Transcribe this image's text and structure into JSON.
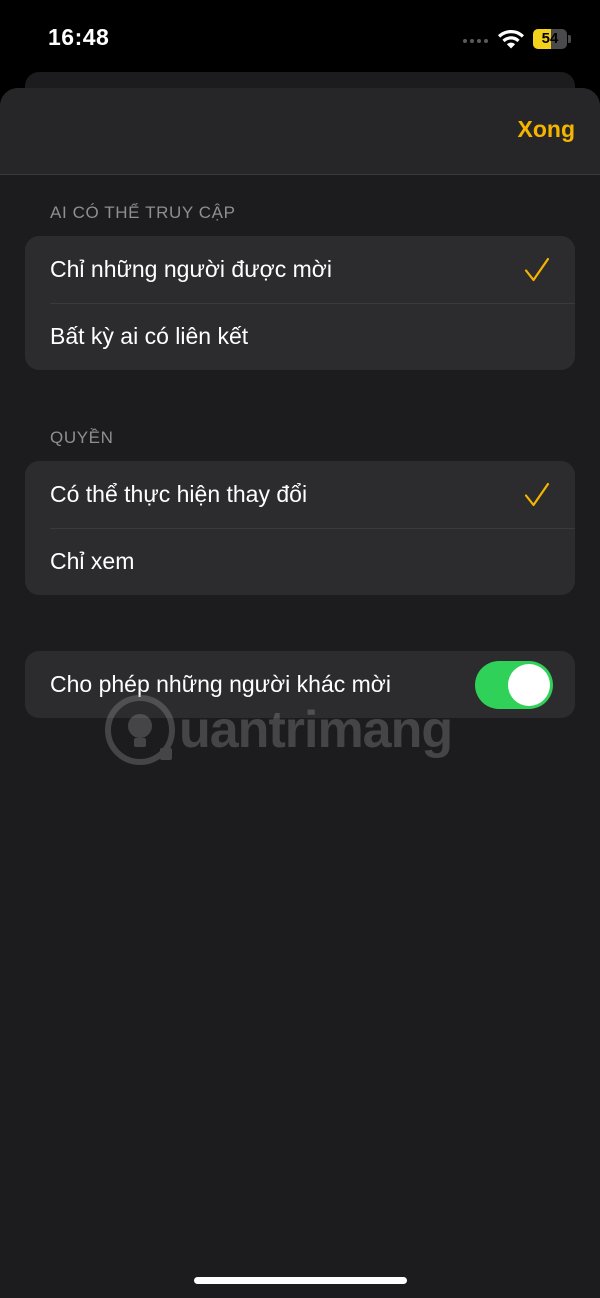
{
  "status_bar": {
    "time": "16:48",
    "battery_level": "54",
    "battery_fraction": 0.54,
    "wifi_icon": "wifi-icon",
    "signal_icon": "cellular-dots-icon"
  },
  "header": {
    "done_label": "Xong"
  },
  "access_section": {
    "title": "AI CÓ THỂ TRUY CẬP",
    "options": [
      {
        "label": "Chỉ những người được mời",
        "selected": true
      },
      {
        "label": "Bất kỳ ai có liên kết",
        "selected": false
      }
    ]
  },
  "permission_section": {
    "title": "QUYỀN",
    "options": [
      {
        "label": "Có thể thực hiện thay đổi",
        "selected": true
      },
      {
        "label": "Chỉ xem",
        "selected": false
      }
    ]
  },
  "invite_toggle": {
    "label": "Cho phép những người khác mời",
    "on": true
  },
  "watermark": {
    "text": "uantrimang",
    "icon": "lightbulb-logo-icon"
  },
  "colors": {
    "accent": "#f5b400",
    "toggle_on": "#30d158",
    "background": "#1c1c1e",
    "cell": "#2c2c2e"
  }
}
